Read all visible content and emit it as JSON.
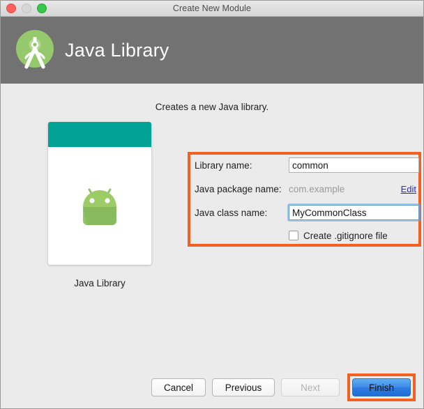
{
  "window": {
    "title": "Create New Module",
    "traffic_lights": [
      {
        "name": "close",
        "color": "#fc615d"
      },
      {
        "name": "minimize",
        "color": "#d6d6d6"
      },
      {
        "name": "zoom",
        "color": "#34c749"
      }
    ]
  },
  "header": {
    "title": "Java Library",
    "icon": "android-studio-logo-icon",
    "background_color": "#727272"
  },
  "body": {
    "subtitle": "Creates a new Java library.",
    "background_color": "#ebebeb"
  },
  "preview": {
    "caption": "Java Library",
    "card_header_color": "#00a396",
    "art_icon": "android-robot-icon",
    "art_color": "#8fc662"
  },
  "form": {
    "highlight_color": "#f26122",
    "rows": [
      {
        "label": "Library name:",
        "type": "input",
        "value": "common",
        "placeholder": "",
        "focused": false
      },
      {
        "label": "Java package name:",
        "type": "static",
        "value": "com.example",
        "link_label": "Edit"
      },
      {
        "label": "Java class name:",
        "type": "input",
        "value": "MyCommonClass",
        "placeholder": "",
        "focused": true
      }
    ],
    "checkbox": {
      "label": "Create .gitignore file",
      "checked": false
    }
  },
  "footer": {
    "buttons": [
      {
        "label": "Cancel",
        "state": "enabled"
      },
      {
        "label": "Previous",
        "state": "enabled"
      },
      {
        "label": "Next",
        "state": "disabled"
      },
      {
        "label": "Finish",
        "state": "default"
      }
    ],
    "highlight_color": "#f26122"
  }
}
